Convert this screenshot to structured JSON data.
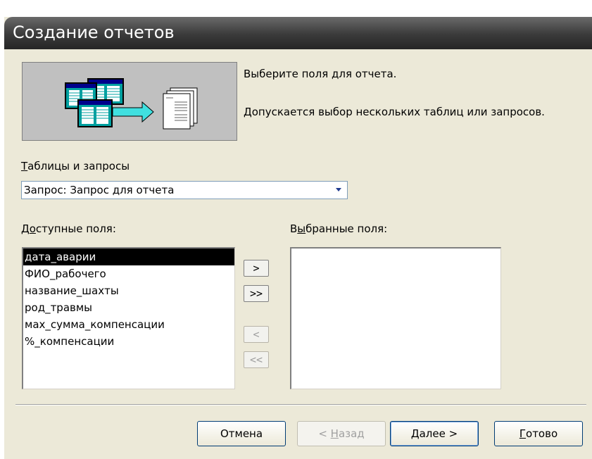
{
  "window": {
    "title": "Создание отчетов"
  },
  "header": {
    "line1": "Выберите поля для отчета.",
    "line2": "Допускается выбор нескольких таблиц или запросов."
  },
  "tables": {
    "label_mnemonic": "Т",
    "label_rest": "аблицы и запросы",
    "selected_value": "Запрос: Запрос для отчета"
  },
  "available_fields": {
    "label_pre": "Д",
    "label_mnemonic": "о",
    "label_rest": "ступные поля:",
    "items": [
      "дата_аварии",
      "ФИО_рабочего",
      "название_шахты",
      "род_травмы",
      "мах_сумма_компенсации",
      "%_компенсации"
    ],
    "selected_index": 0
  },
  "selected_fields": {
    "label_pre": "В",
    "label_mnemonic": "ы",
    "label_rest": "бранные поля:",
    "items": []
  },
  "move_buttons": {
    "add_one": ">",
    "add_all": ">>",
    "remove_one": "<",
    "remove_all": "<<"
  },
  "footer": {
    "cancel": "Отмена",
    "back_pre": "< ",
    "back_mnemonic": "Н",
    "back_rest": "азад",
    "next_mnemonic": "Д",
    "next_rest": "алее >",
    "finish_mnemonic": "Г",
    "finish_rest": "отово"
  },
  "colors": {
    "selection": "#000000",
    "dialog_bg": "#ece9d8",
    "title_bg": "#3a3a3a"
  }
}
